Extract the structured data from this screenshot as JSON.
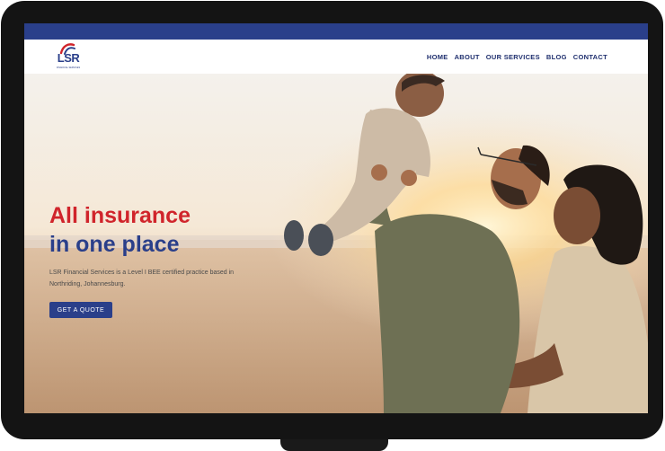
{
  "brand": {
    "logo_text": "LSR",
    "logo_subtext": "FINANCIAL SERVICES",
    "navy": "#2a3f8a",
    "red": "#d0242b"
  },
  "nav": {
    "items": [
      {
        "label": "HOME"
      },
      {
        "label": "ABOUT"
      },
      {
        "label": "OUR SERVICES"
      },
      {
        "label": "BLOG"
      },
      {
        "label": "CONTACT"
      }
    ]
  },
  "hero": {
    "headline_line1": "All insurance",
    "headline_line2": "in one place",
    "subtext": "LSR Financial Services is a Level I BEE certified practice based in Northriding, Johannesburg.",
    "cta_label": "GET A QUOTE",
    "image": "family-on-beach-at-sunset-photo"
  }
}
